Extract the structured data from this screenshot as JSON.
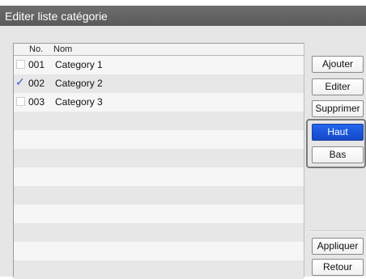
{
  "window": {
    "title": "Editer liste catégorie"
  },
  "list": {
    "headers": {
      "no": "No.",
      "nom": "Nom"
    },
    "items": [
      {
        "no": "001",
        "name": "Category 1",
        "checked": false
      },
      {
        "no": "002",
        "name": "Category 2",
        "checked": true,
        "check_glyph": "✓"
      },
      {
        "no": "003",
        "name": "Category 3",
        "checked": false
      }
    ]
  },
  "buttons": {
    "ajouter": "Ajouter",
    "editer": "Editer",
    "supprimer": "Supprimer",
    "haut": "Haut",
    "bas": "Bas",
    "appliquer": "Appliquer",
    "retour": "Retour"
  },
  "colors": {
    "title_bar": "#5f5f5f",
    "selected_button": "#1a55dd",
    "check": "#3a5fd0"
  }
}
